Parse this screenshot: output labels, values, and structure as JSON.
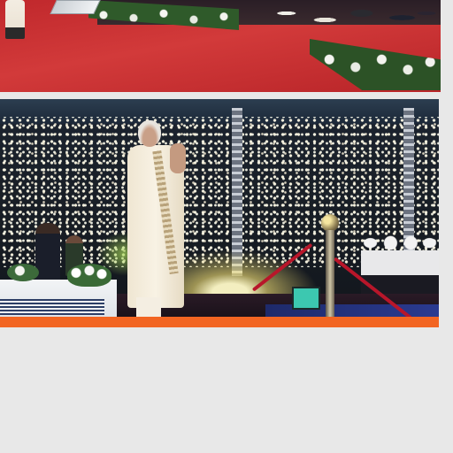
{
  "feed": {
    "photos": [
      {
        "icon": "event-photo-red-carpet"
      },
      {
        "icon": "event-photo-stadium-night"
      }
    ],
    "card_accent_color": "#f26522",
    "background_color": "#e8e8e8"
  }
}
